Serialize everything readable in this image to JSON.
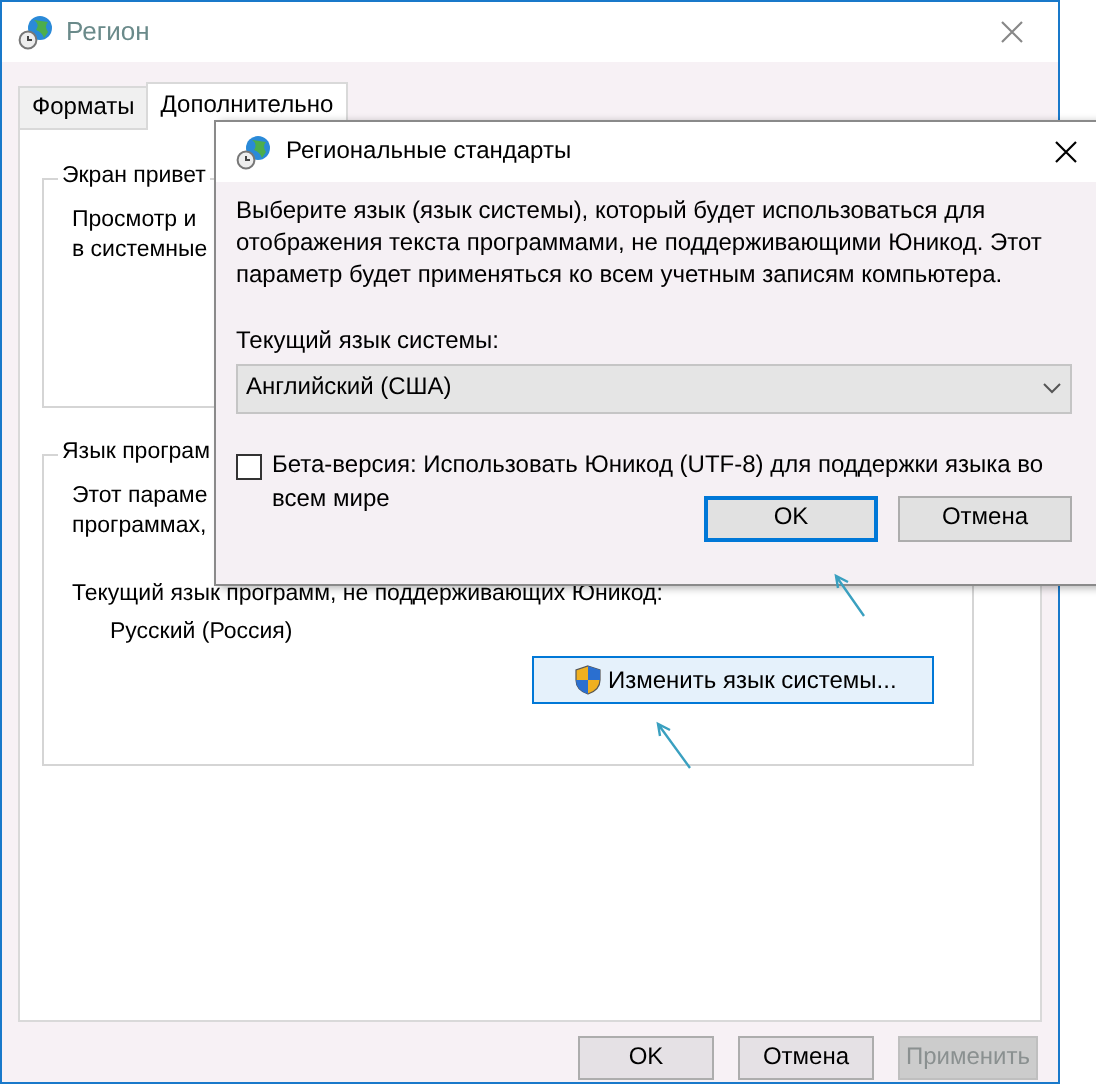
{
  "window": {
    "title": "Регион"
  },
  "tabs": [
    {
      "label": "Форматы",
      "selected": false
    },
    {
      "label": "Дополнительно",
      "selected": true
    }
  ],
  "groups": [
    {
      "title": "Экран привет",
      "lines": [
        "Просмотр и",
        "в системные"
      ]
    },
    {
      "title": "Язык програм",
      "lines": [
        "Этот параме",
        "программах,"
      ],
      "current_label": "Текущий язык программ, не поддерживающих Юникод:",
      "current_value": "Русский (Россия)",
      "button": "Изменить язык системы..."
    }
  ],
  "buttons": [
    {
      "label": "OK",
      "disabled": false
    },
    {
      "label": "Отмена",
      "disabled": false
    },
    {
      "label": "Применить",
      "disabled": true
    }
  ],
  "dialog": {
    "title": "Региональные стандарты",
    "description": "Выберите язык (язык системы), который будет использоваться для отображения текста программами, не поддерживающими Юникод. Этот параметр будет применяться ко всем учетным записям компьютера.",
    "select_label": "Текущий язык системы:",
    "select_value": "Английский (США)",
    "checkbox": {
      "label": "Бета-версия: Использовать Юникод (UTF-8) для поддержки языка во всем мире",
      "checked": false
    },
    "buttons": [
      {
        "label": "OK",
        "default": true
      },
      {
        "label": "Отмена",
        "default": false
      }
    ]
  }
}
